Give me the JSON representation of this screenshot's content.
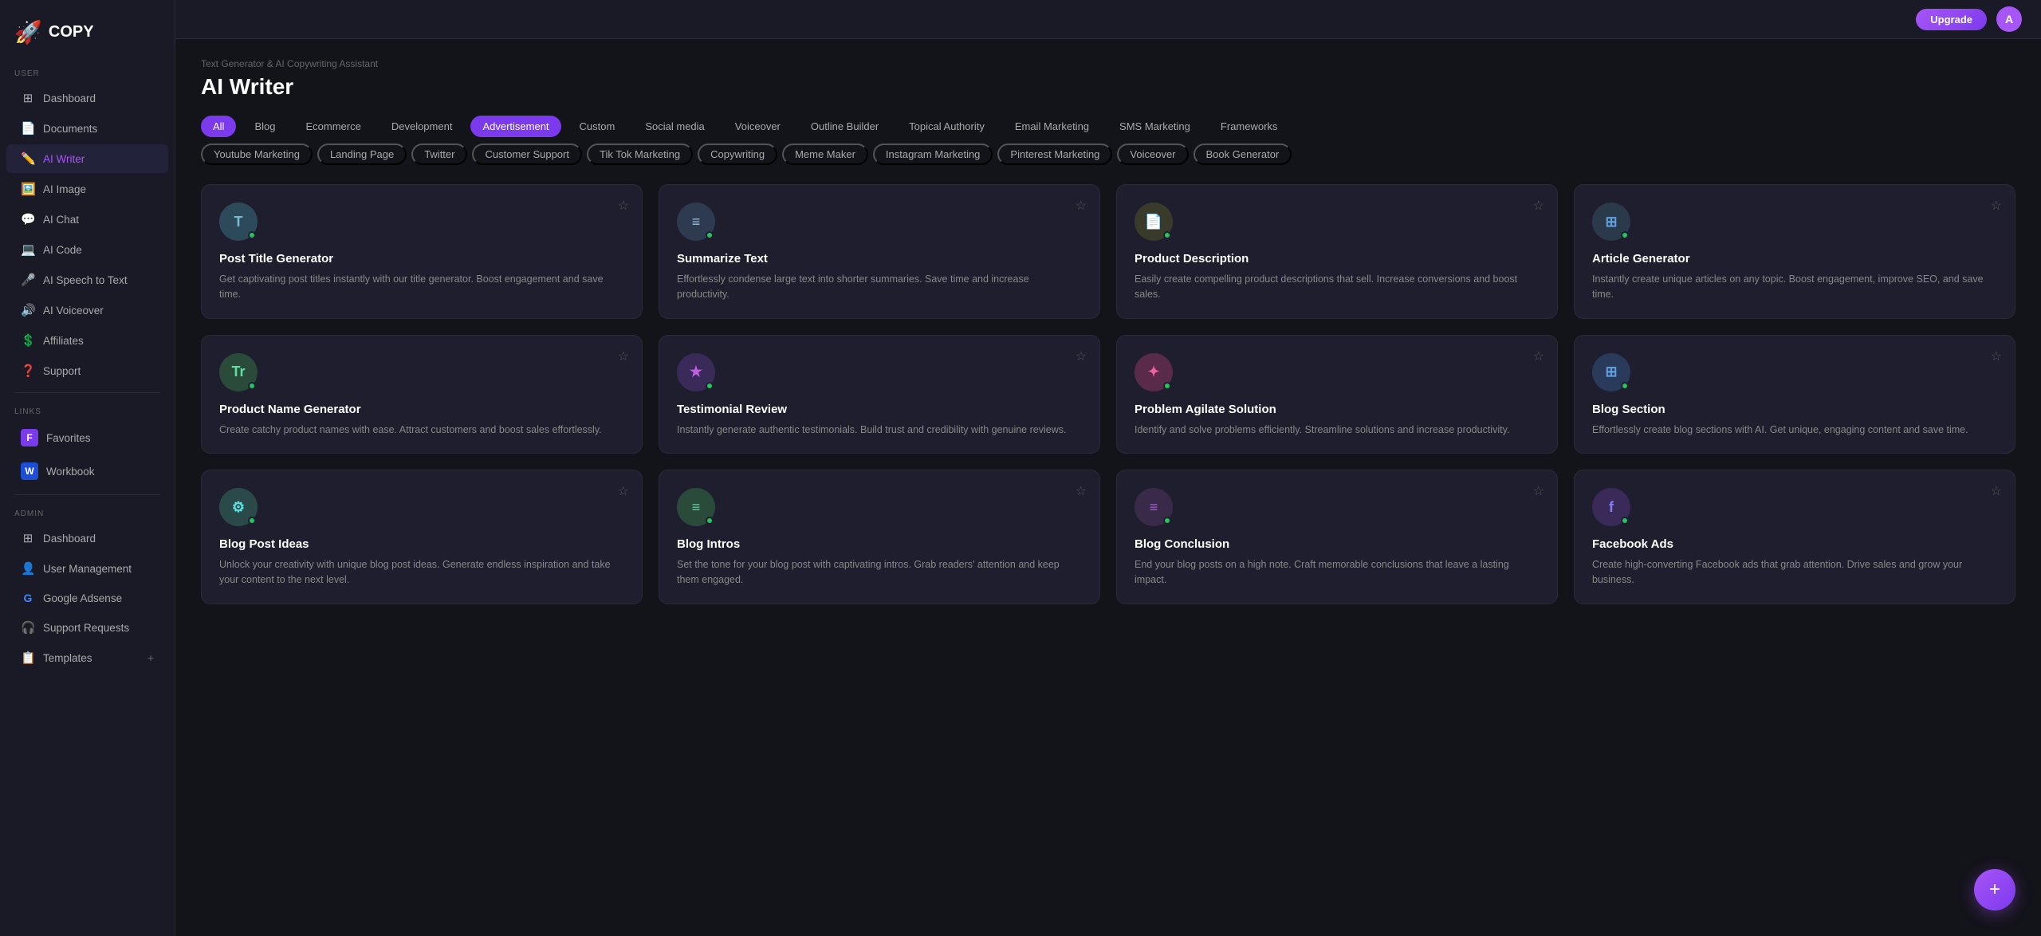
{
  "sidebar": {
    "logo": "COPY",
    "logo_emoji": "🚀",
    "collapse_icon": "‹",
    "sections": [
      {
        "label": "USER",
        "items": [
          {
            "id": "dashboard",
            "icon": "⊞",
            "label": "Dashboard",
            "active": false
          },
          {
            "id": "documents",
            "icon": "📄",
            "label": "Documents",
            "active": false
          },
          {
            "id": "ai-writer",
            "icon": "✏️",
            "label": "AI Writer",
            "active": true
          },
          {
            "id": "ai-image",
            "icon": "🖼️",
            "label": "AI Image",
            "active": false
          },
          {
            "id": "ai-chat",
            "icon": "💬",
            "label": "AI Chat",
            "active": false
          },
          {
            "id": "ai-code",
            "icon": "💻",
            "label": "AI Code",
            "active": false
          },
          {
            "id": "ai-speech",
            "icon": "🎤",
            "label": "AI Speech to Text",
            "active": false
          },
          {
            "id": "ai-voiceover",
            "icon": "🔊",
            "label": "AI Voiceover",
            "active": false
          },
          {
            "id": "affiliates",
            "icon": "💲",
            "label": "Affiliates",
            "active": false
          },
          {
            "id": "support",
            "icon": "❓",
            "label": "Support",
            "active": false
          }
        ]
      },
      {
        "label": "LINKS",
        "items": [
          {
            "id": "favorites",
            "icon": "F",
            "label": "Favorites",
            "active": false,
            "color": "#7c3aed"
          },
          {
            "id": "workbook",
            "icon": "W",
            "label": "Workbook",
            "active": false,
            "color": "#1d4ed8"
          }
        ]
      },
      {
        "label": "ADMIN",
        "items": [
          {
            "id": "admin-dashboard",
            "icon": "⊞",
            "label": "Dashboard",
            "active": false
          },
          {
            "id": "user-management",
            "icon": "👤",
            "label": "User Management",
            "active": false
          },
          {
            "id": "google-adsense",
            "icon": "G",
            "label": "Google Adsense",
            "active": false
          },
          {
            "id": "support-requests",
            "icon": "🎧",
            "label": "Support Requests",
            "active": false
          },
          {
            "id": "templates",
            "icon": "📋",
            "label": "Templates",
            "active": false,
            "has_plus": true
          }
        ]
      }
    ]
  },
  "topbar": {
    "upgrade_label": "Upgrade",
    "avatar_initials": "A"
  },
  "breadcrumb": "Text Generator & AI Copywriting Assistant",
  "page_title": "AI Writer",
  "filter_tabs": [
    {
      "id": "all",
      "label": "All",
      "active": true
    },
    {
      "id": "blog",
      "label": "Blog",
      "active": false
    },
    {
      "id": "ecommerce",
      "label": "Ecommerce",
      "active": false
    },
    {
      "id": "development",
      "label": "Development",
      "active": false
    },
    {
      "id": "advertisement",
      "label": "Advertisement",
      "active": false
    },
    {
      "id": "custom",
      "label": "Custom",
      "active": false
    },
    {
      "id": "social-media",
      "label": "Social media",
      "active": false
    },
    {
      "id": "voiceover",
      "label": "Voiceover",
      "active": false
    },
    {
      "id": "outline-builder",
      "label": "Outline Builder",
      "active": false
    },
    {
      "id": "topical-authority",
      "label": "Topical Authority",
      "active": false
    },
    {
      "id": "email-marketing",
      "label": "Email Marketing",
      "active": false
    },
    {
      "id": "sms-marketing",
      "label": "SMS Marketing",
      "active": false
    },
    {
      "id": "frameworks",
      "label": "Frameworks",
      "active": false
    }
  ],
  "sub_tabs": [
    {
      "id": "youtube-marketing",
      "label": "Youtube Marketing"
    },
    {
      "id": "landing-page",
      "label": "Landing Page"
    },
    {
      "id": "twitter",
      "label": "Twitter"
    },
    {
      "id": "customer-support",
      "label": "Customer Support"
    },
    {
      "id": "tik-tok-marketing",
      "label": "Tik Tok Marketing"
    },
    {
      "id": "copywriting",
      "label": "Copywriting"
    },
    {
      "id": "meme-maker",
      "label": "Meme Maker"
    },
    {
      "id": "instagram-marketing",
      "label": "Instagram Marketing"
    },
    {
      "id": "pinterest-marketing",
      "label": "Pinterest Marketing"
    },
    {
      "id": "voiceover2",
      "label": "Voiceover"
    },
    {
      "id": "book-generator",
      "label": "Book Generator"
    }
  ],
  "cards": [
    {
      "id": "post-title-generator",
      "icon": "T",
      "icon_bg": "#2d4a5a",
      "icon_color": "#fff",
      "title": "Post Title Generator",
      "desc": "Get captivating post titles instantly with our title generator. Boost engagement and save time."
    },
    {
      "id": "summarize-text",
      "icon": "≡",
      "icon_bg": "#2d3a50",
      "icon_color": "#a0c0e0",
      "title": "Summarize Text",
      "desc": "Effortlessly condense large text into shorter summaries. Save time and increase productivity."
    },
    {
      "id": "product-description",
      "icon": "📄",
      "icon_bg": "#3a3a2a",
      "icon_color": "#e0c060",
      "title": "Product Description",
      "desc": "Easily create compelling product descriptions that sell. Increase conversions and boost sales."
    },
    {
      "id": "article-generator",
      "icon": "⊞",
      "icon_bg": "#2a3a4a",
      "icon_color": "#60a0e0",
      "title": "Article Generator",
      "desc": "Instantly create unique articles on any topic. Boost engagement, improve SEO, and save time."
    },
    {
      "id": "product-name-generator",
      "icon": "Tr",
      "icon_bg": "#2a4a3a",
      "icon_color": "#60e0a0",
      "title": "Product Name Generator",
      "desc": "Create catchy product names with ease. Attract customers and boost sales effortlessly."
    },
    {
      "id": "testimonial-review",
      "icon": "★",
      "icon_bg": "#3a2a5a",
      "icon_color": "#c060e0",
      "title": "Testimonial Review",
      "desc": "Instantly generate authentic testimonials. Build trust and credibility with genuine reviews."
    },
    {
      "id": "problem-agilate-solution",
      "icon": "✦",
      "icon_bg": "#5a2a4a",
      "icon_color": "#f060a0",
      "title": "Problem Agilate Solution",
      "desc": "Identify and solve problems efficiently. Streamline solutions and increase productivity."
    },
    {
      "id": "blog-section",
      "icon": "⊞",
      "icon_bg": "#2a3a5a",
      "icon_color": "#60a0e0",
      "title": "Blog Section",
      "desc": "Effortlessly create blog sections with AI. Get unique, engaging content and save time."
    },
    {
      "id": "blog-post-ideas",
      "icon": "⚙",
      "icon_bg": "#2a4a4a",
      "icon_color": "#60e0e0",
      "title": "Blog Post Ideas",
      "desc": "Unlock your creativity with unique blog post ideas. Generate endless inspiration and take your content to the next level."
    },
    {
      "id": "blog-intros",
      "icon": "≡",
      "icon_bg": "#2a4a3a",
      "icon_color": "#60d0a0",
      "title": "Blog Intros",
      "desc": "Set the tone for your blog post with captivating intros. Grab readers' attention and keep them engaged."
    },
    {
      "id": "blog-conclusion",
      "icon": "≡",
      "icon_bg": "#3a2a4a",
      "icon_color": "#a060d0",
      "title": "Blog Conclusion",
      "desc": "End your blog posts on a high note. Craft memorable conclusions that leave a lasting impact."
    },
    {
      "id": "facebook-ads",
      "icon": "f",
      "icon_bg": "#3a2a5a",
      "icon_color": "#8080f0",
      "title": "Facebook Ads",
      "desc": "Create high-converting Facebook ads that grab attention. Drive sales and grow your business."
    }
  ],
  "fab_icon": "+"
}
